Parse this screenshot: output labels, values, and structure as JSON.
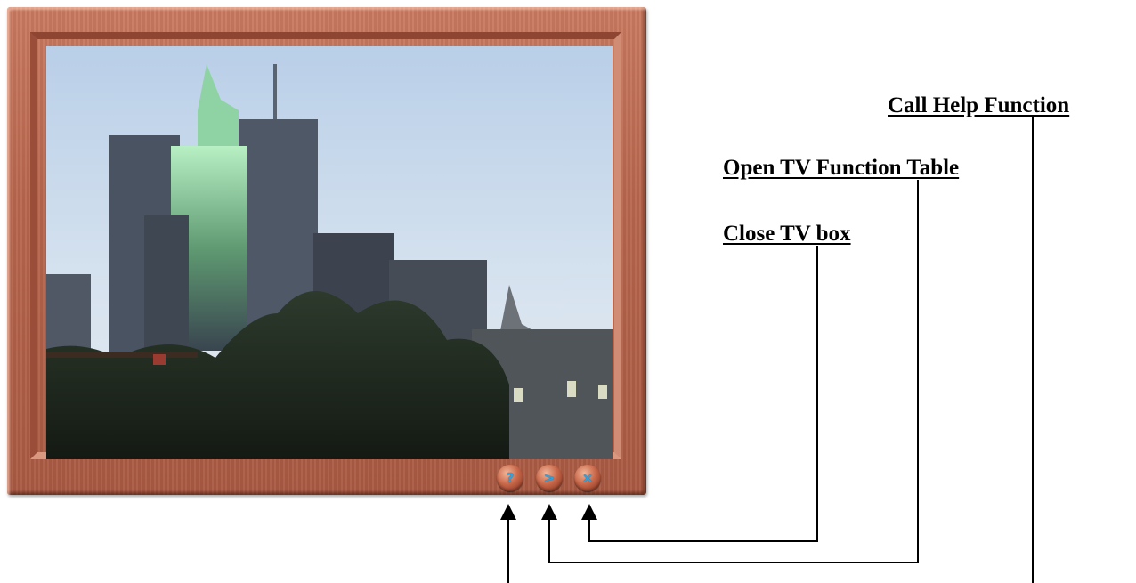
{
  "tv_box": {
    "buttons": [
      {
        "name": "help",
        "glyph": "?"
      },
      {
        "name": "function-table",
        "glyph": ">"
      },
      {
        "name": "close",
        "glyph": "×"
      }
    ],
    "frame_color": "#b8664d",
    "button_glyph_color": "#2fa3e0"
  },
  "callouts": {
    "help": "Call Help Function",
    "function_table": "Open TV Function Table",
    "close": "Close TV box"
  },
  "connector_color": "#000000"
}
